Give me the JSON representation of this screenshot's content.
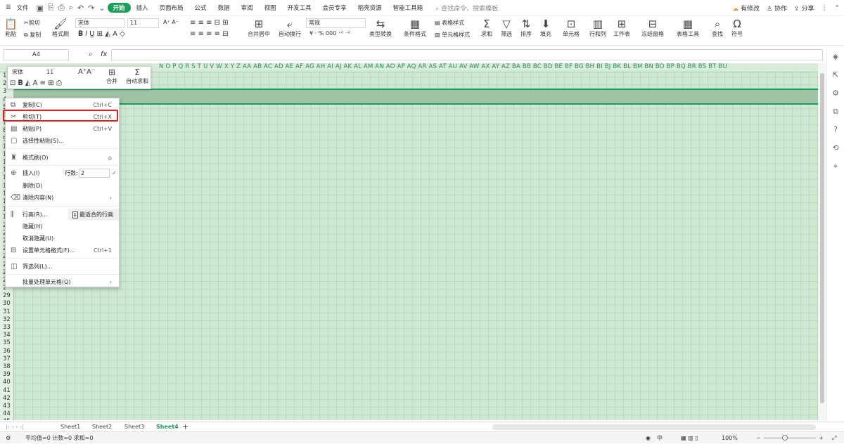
{
  "menubar": {
    "file": "文件",
    "tabs": [
      "开始",
      "插入",
      "页面布局",
      "公式",
      "数据",
      "审阅",
      "视图",
      "开发工具",
      "会员专享",
      "稻壳资源",
      "智能工具箱"
    ],
    "search": "查找命令、搜索模板",
    "modified": "有修改",
    "collab": "协作",
    "share": "分享"
  },
  "ribbon": {
    "paste": "粘贴",
    "cut": "剪切",
    "copy": "复制",
    "format_painter": "格式刷",
    "font": "宋体",
    "size": "11",
    "merge_center": "合并居中",
    "wrap": "自动换行",
    "number_format": "常规",
    "type_convert": "类型转换",
    "cond_format": "条件格式",
    "table_style": "表格样式",
    "cell_style": "单元格样式",
    "sum": "求和",
    "filter": "筛选",
    "sort": "排序",
    "fill": "填充",
    "cell": "单元格",
    "rowcol": "行和列",
    "worksheet": "工作表",
    "freeze": "冻结窗格",
    "table_tools": "表格工具",
    "find": "查找",
    "symbol": "符号",
    "currency": "¥",
    "percent": "%",
    "thousands": "000"
  },
  "formula_bar": {
    "name_box": "A4",
    "fx": "fx"
  },
  "columns": "N  O  P  Q  R  S  T  U  V  W  X  Y  Z  AA AB AC AD AE AF AG AH AI  AJ  AK AL AM AN AO AP AQ AR AS AT AU AV AW AX AY AZ BA BB BC BD BE BF BG BH  BI  BJ  BK BL BM BN BO BP BQ BR BS BT BU",
  "rows": [
    "1",
    "2",
    "3",
    "4",
    "5",
    "6",
    "7",
    "8",
    "9",
    "1",
    "1",
    "1",
    "1",
    "1",
    "1",
    "1",
    "1",
    "1",
    "1",
    "2",
    "2",
    "2",
    "2",
    "2",
    "2",
    "2",
    "2",
    "2",
    "29",
    "30",
    "31",
    "32",
    "33",
    "34",
    "35",
    "36",
    "37",
    "38",
    "39",
    "40",
    "41",
    "42",
    "43",
    "44",
    "45"
  ],
  "mini_toolbar": {
    "font": "宋体",
    "size": "11",
    "merge": "合并",
    "autosum": "自动求和"
  },
  "context_menu": {
    "copy": "复制(C)",
    "copy_key": "Ctrl+C",
    "cut": "剪切(T)",
    "cut_key": "Ctrl+X",
    "paste": "粘贴(P)",
    "paste_key": "Ctrl+V",
    "paste_special": "选择性粘贴(S)...",
    "format_painter": "格式刷(O)",
    "insert": "插入(I)",
    "rows_label": "行数:",
    "rows_value": "2",
    "delete": "删除(D)",
    "clear": "清除内容(N)",
    "row_height": "行高(R)...",
    "best_fit": "最适合的行高",
    "hide": "隐藏(H)",
    "unhide": "取消隐藏(U)",
    "format_cells": "设置单元格格式(F)...",
    "format_key": "Ctrl+1",
    "filter_col": "筛选列(L)...",
    "batch": "批量处理单元格(Q)"
  },
  "sheets": [
    "Sheet1",
    "Sheet2",
    "Sheet3",
    "Sheet4"
  ],
  "active_sheet": "Sheet4",
  "status": {
    "stats": "平均值=0  计数=0  求和=0",
    "zoom": "100%",
    "lang": "中"
  },
  "colors": {
    "accent": "#1b9e58",
    "highlight": "#e02020"
  }
}
